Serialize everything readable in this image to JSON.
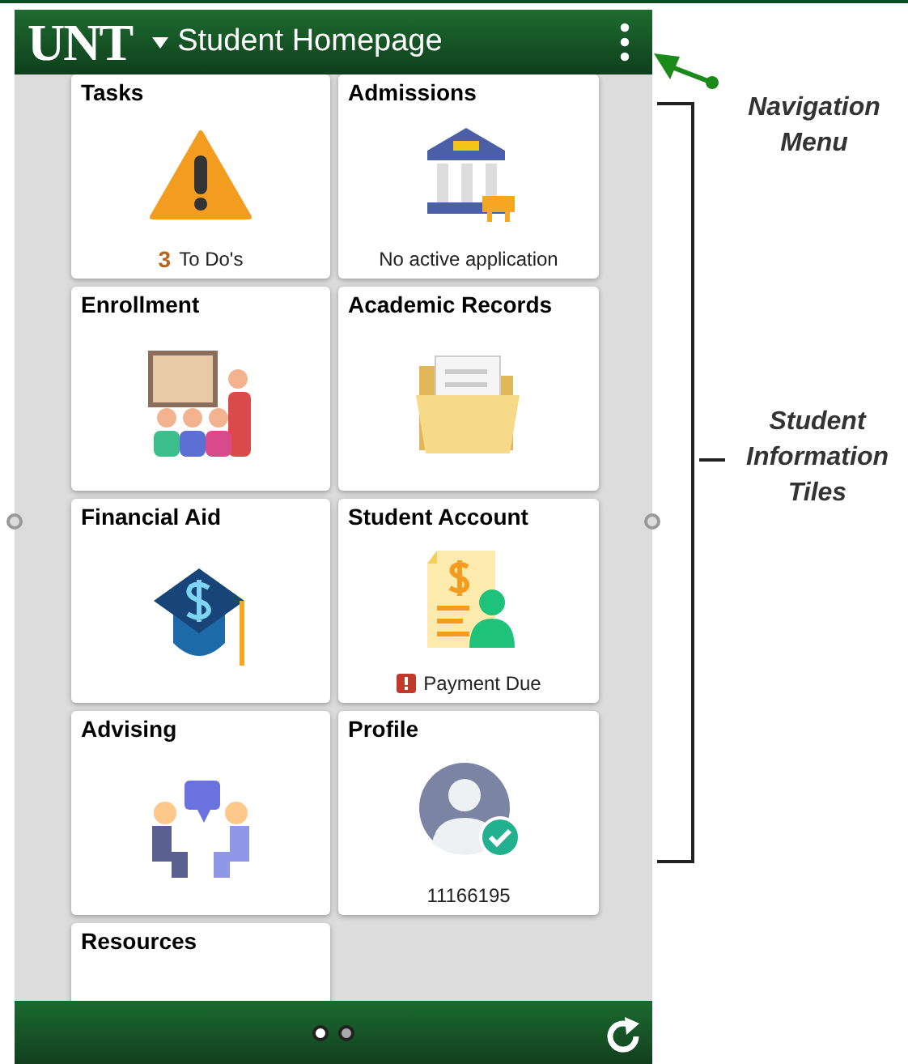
{
  "header": {
    "logo": "UNT",
    "title": "Student Homepage"
  },
  "tiles": [
    {
      "title": "Tasks",
      "kind": "tasks",
      "count": "3",
      "note": "To Do's"
    },
    {
      "title": "Admissions",
      "kind": "admissions",
      "note": "No active application"
    },
    {
      "title": "Enrollment",
      "kind": "enrollment"
    },
    {
      "title": "Academic Records",
      "kind": "records"
    },
    {
      "title": "Financial Aid",
      "kind": "aid"
    },
    {
      "title": "Student Account",
      "kind": "account",
      "note": "Payment Due",
      "alert": true
    },
    {
      "title": "Advising",
      "kind": "advising"
    },
    {
      "title": "Profile",
      "kind": "profile",
      "note": "11166195"
    },
    {
      "title": "Resources",
      "kind": "resources"
    }
  ],
  "pager": [
    {
      "selected": true
    },
    {
      "selected": false
    }
  ],
  "annotations": [
    {
      "kind": "arrow",
      "text": "Navigation Menu"
    },
    {
      "kind": "bracket",
      "text": "Student Information Tiles"
    }
  ]
}
